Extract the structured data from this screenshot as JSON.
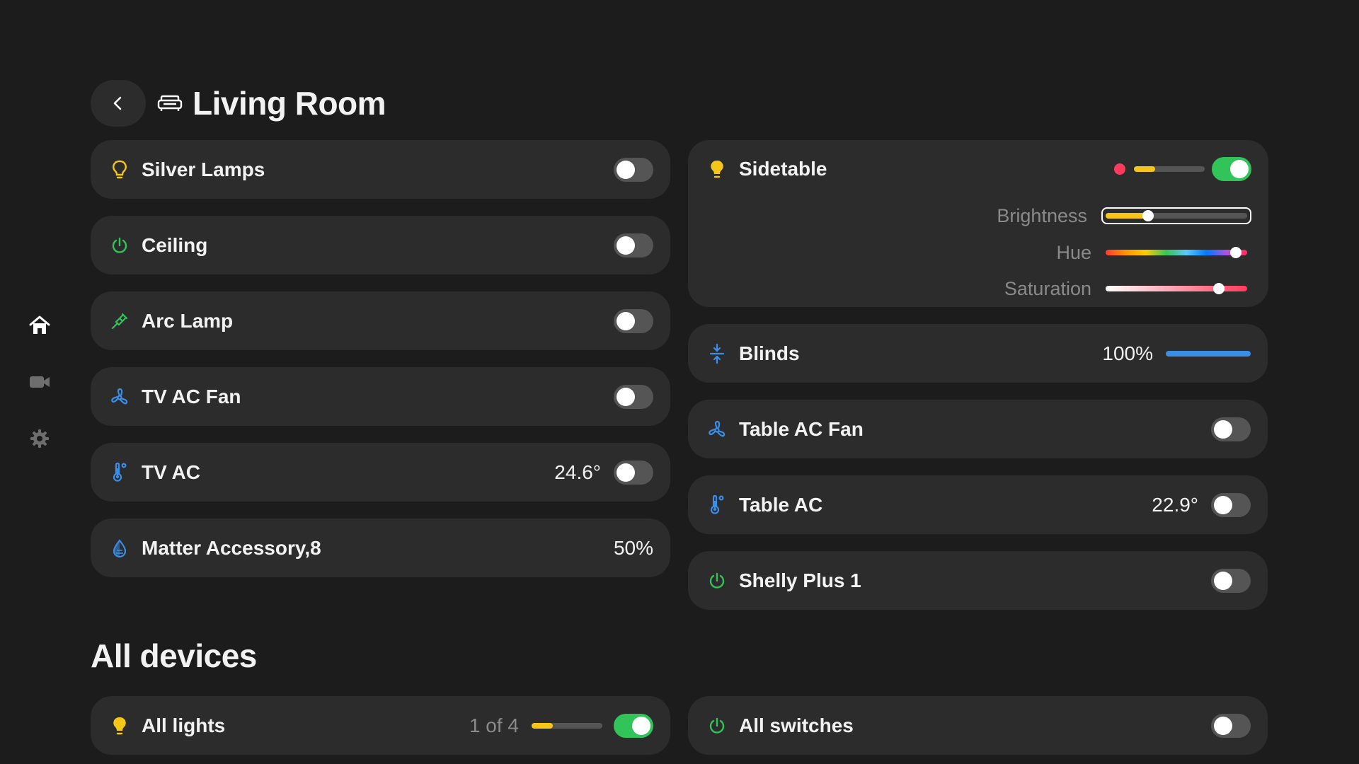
{
  "header": {
    "title": "Living Room"
  },
  "sidebar": {
    "items": [
      "home-icon",
      "camera-icon",
      "gear-icon"
    ]
  },
  "left_tiles": [
    {
      "name": "Silver Lamps",
      "icon": "lightbulb-outline-icon",
      "on": false
    },
    {
      "name": "Ceiling",
      "icon": "power-icon",
      "on": false
    },
    {
      "name": "Arc Lamp",
      "icon": "plug-icon",
      "on": false
    },
    {
      "name": "TV AC Fan",
      "icon": "fan-icon",
      "on": false
    },
    {
      "name": "TV AC",
      "icon": "thermometer-icon",
      "value": "24.6°",
      "on": false
    },
    {
      "name": "Matter Accessory,8",
      "icon": "humidity-icon",
      "value": "50%"
    }
  ],
  "sidetable": {
    "name": "Sidetable",
    "on": true,
    "brightness_label": "Brightness",
    "hue_label": "Hue",
    "saturation_label": "Saturation",
    "brightness_level": 0.3,
    "hue_level": 0.92,
    "saturation_level": 0.8,
    "color": "#ff3b5c"
  },
  "right_tiles": [
    {
      "name": "Blinds",
      "icon": "blinds-icon",
      "value": "100%"
    },
    {
      "name": "Table AC Fan",
      "icon": "fan-icon",
      "on": false
    },
    {
      "name": "Table AC",
      "icon": "thermometer-icon",
      "value": "22.9°",
      "on": false
    },
    {
      "name": "Shelly Plus 1",
      "icon": "power-icon",
      "on": false
    }
  ],
  "all_devices": {
    "title": "All devices",
    "lights": {
      "name": "All lights",
      "count": "1 of 4",
      "on": true,
      "level": 0.3
    },
    "switches": {
      "name": "All switches",
      "on": false
    }
  },
  "colors": {
    "yellow": "#f5c518",
    "green": "#30c459",
    "blue": "#3a8ee6",
    "toggle_off": "#555555"
  }
}
